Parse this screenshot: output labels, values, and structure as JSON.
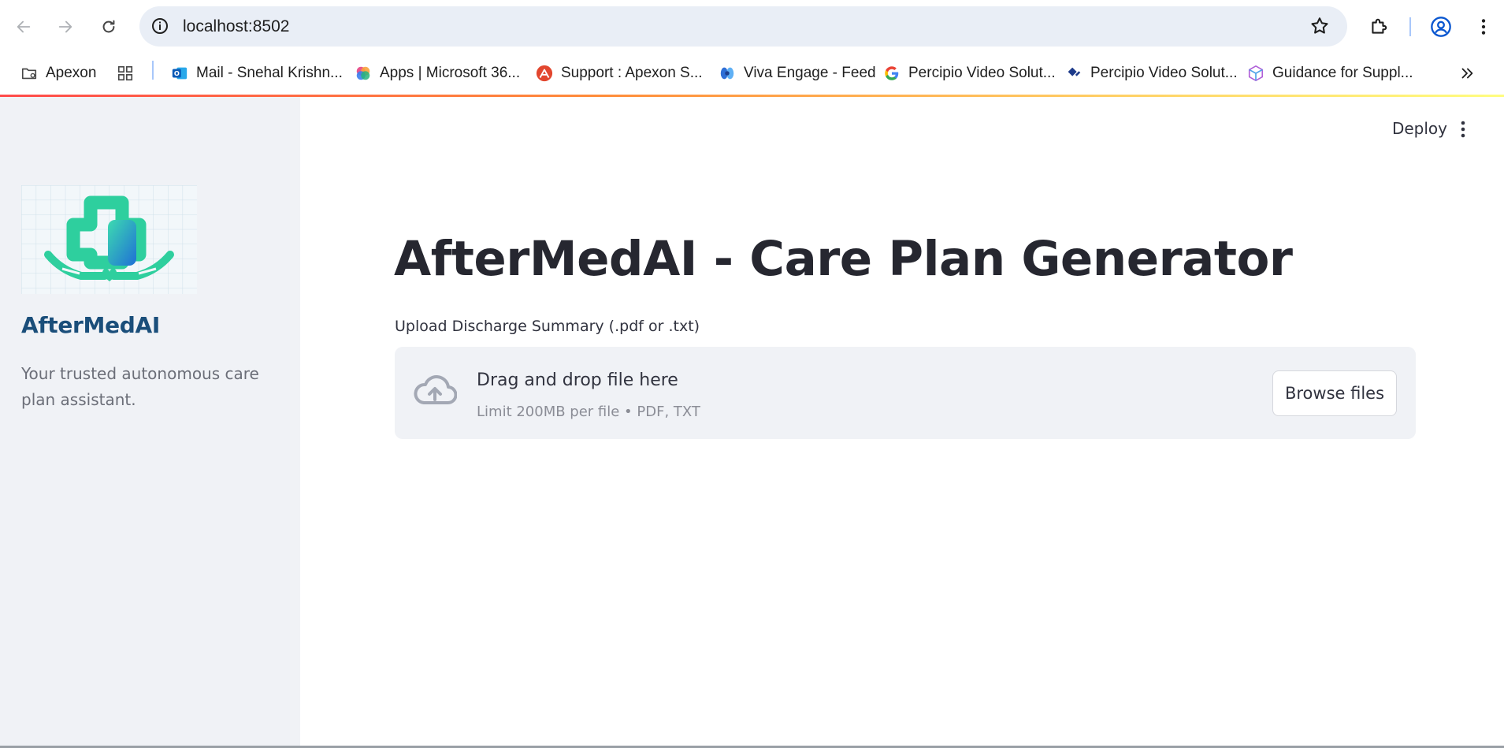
{
  "browser": {
    "url": "localhost:8502",
    "bookmarks": [
      {
        "label": "Apexon",
        "icon": "folder-icon"
      },
      {
        "label": "Mail - Snehal Krishn...",
        "icon": "outlook-icon"
      },
      {
        "label": "Apps | Microsoft 36...",
        "icon": "microsoft365-icon"
      },
      {
        "label": "Support : Apexon S...",
        "icon": "support-icon"
      },
      {
        "label": "Viva Engage - Feed",
        "icon": "viva-engage-icon"
      },
      {
        "label": "Percipio Video Solut...",
        "icon": "google-icon"
      },
      {
        "label": "Percipio Video Solut...",
        "icon": "percipio-icon"
      },
      {
        "label": "Guidance for Suppl...",
        "icon": "cube-icon"
      }
    ]
  },
  "sidebar": {
    "app_name": "AfterMedAI",
    "tagline": "Your trusted autonomous care plan assistant."
  },
  "header": {
    "deploy_label": "Deploy"
  },
  "main": {
    "title": "AfterMedAI - Care Plan Generator",
    "upload_label": "Upload Discharge Summary (.pdf or .txt)",
    "dropzone": {
      "title": "Drag and drop file here",
      "limit": "Limit 200MB per file • PDF, TXT",
      "browse_label": "Browse files"
    }
  },
  "colors": {
    "sidebar_bg": "#f0f2f6",
    "brand_blue": "#1a4e7a",
    "accent_red": "#ff4b4b",
    "logo_teal": "#2ecf9e"
  }
}
